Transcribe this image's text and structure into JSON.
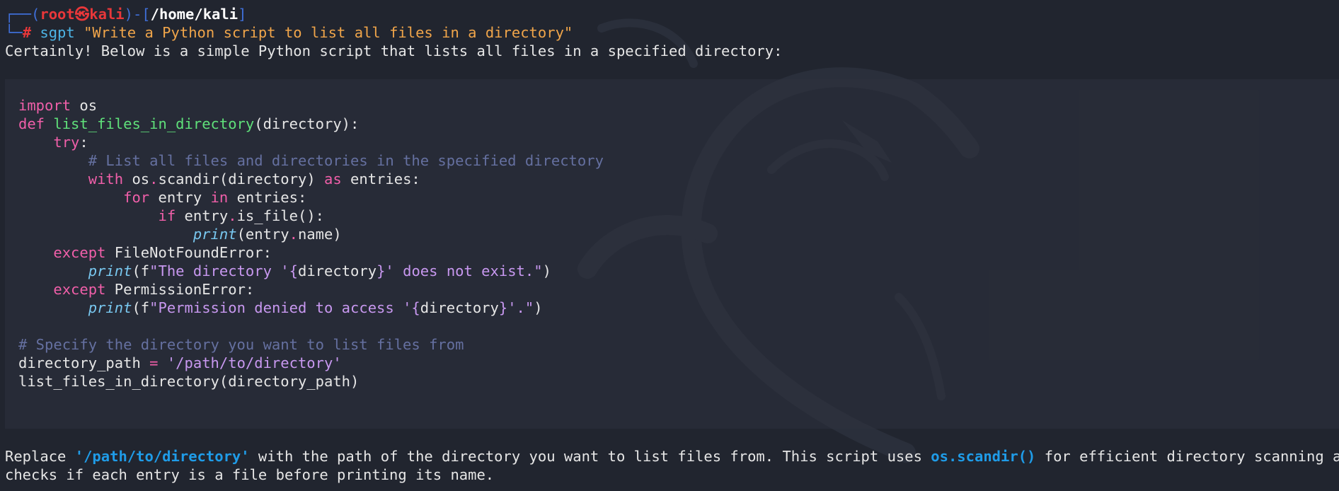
{
  "prompt": {
    "user": "root",
    "skull": "㉿",
    "host": "kali",
    "path": "/home/kali",
    "symbol": "#",
    "command": "sgpt",
    "argument": "\"Write a Python script to list all files in a directory\""
  },
  "intro": "Certainly! Below is a simple Python script that lists all files in a specified directory:",
  "code": {
    "l1_kw": "import",
    "l1_rest": " os",
    "l2_kw": "def",
    "l2_fn": "list_files_in_directory",
    "l2_rest": "(directory):",
    "l3_kw": "try",
    "l3_rest": ":",
    "l4_cm": "# List all files and directories in the specified directory",
    "l5_kw": "with",
    "l5_a": " os",
    "l5_dot": ".",
    "l5_b": "scandir(directory) ",
    "l5_kw2": "as",
    "l5_c": " entries:",
    "l6_kw": "for",
    "l6_a": " entry ",
    "l6_kw2": "in",
    "l6_b": " entries:",
    "l7_kw": "if",
    "l7_a": " entry",
    "l7_dot": ".",
    "l7_b": "is_file():",
    "l8_bi": "print",
    "l8_a": "(entry",
    "l8_dot": ".",
    "l8_b": "name)",
    "l9_kw": "except",
    "l9_rest": " FileNotFoundError:",
    "l10_bi": "print",
    "l10_a": "(f",
    "l10_s1": "\"The directory '",
    "l10_br1": "{",
    "l10_var": "directory",
    "l10_br2": "}",
    "l10_s2": "' does not exist.\"",
    "l10_end": ")",
    "l11_kw": "except",
    "l11_rest": " PermissionError:",
    "l12_bi": "print",
    "l12_a": "(f",
    "l12_s1": "\"Permission denied to access '",
    "l12_br1": "{",
    "l12_var": "directory",
    "l12_br2": "}",
    "l12_s2": "'.\"",
    "l12_end": ")",
    "l13_cm": "# Specify the directory you want to list files from",
    "l14_a": "directory_path ",
    "l14_op": "=",
    "l14_sp": " ",
    "l14_s": "'/path/to/directory'",
    "l15": "list_files_in_directory(directory_path)"
  },
  "outro": {
    "p1": "Replace ",
    "hl1": "'/path/to/directory'",
    "p2": " with the path of the directory you want to list files from. This script uses ",
    "hl2": "os.scandir()",
    "p3": " for efficient directory scanning and",
    "line2": "checks if each entry is a file before printing its name."
  },
  "colors": {
    "background": "#21252f",
    "prompt_frame": "#3f6fd8",
    "root_user": "#e8373a",
    "keyword": "#f05fa9",
    "function": "#5fe07a",
    "comment": "#6570a0",
    "string": "#c898f0",
    "highlight": "#1f9ce8"
  }
}
